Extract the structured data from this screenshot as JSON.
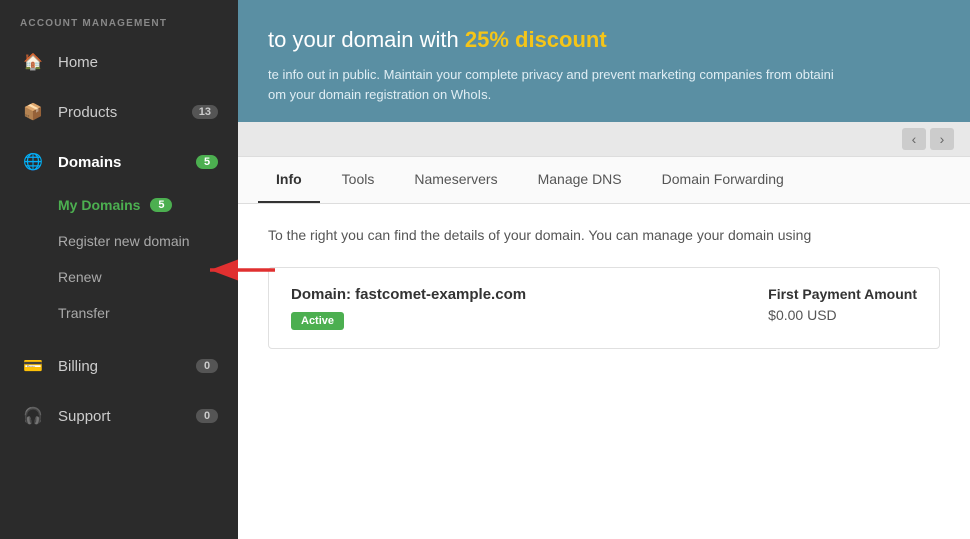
{
  "sidebar": {
    "section_label": "ACCOUNT MANAGEMENT",
    "items": [
      {
        "id": "home",
        "label": "Home",
        "icon": "🏠",
        "badge": null,
        "active": false
      },
      {
        "id": "products",
        "label": "Products",
        "icon": "📦",
        "badge": "13",
        "badge_color": "gray",
        "active": false
      },
      {
        "id": "domains",
        "label": "Domains",
        "icon": "🌐",
        "badge": "5",
        "badge_color": "green",
        "active": true
      },
      {
        "id": "billing",
        "label": "Billing",
        "icon": "💳",
        "badge": "0",
        "badge_color": "gray",
        "active": false
      },
      {
        "id": "support",
        "label": "Support",
        "icon": "🎧",
        "badge": "0",
        "badge_color": "gray",
        "active": false
      }
    ],
    "submenu": [
      {
        "id": "my-domains",
        "label": "My Domains",
        "badge": "5",
        "active": true
      },
      {
        "id": "register-new",
        "label": "Register new domain",
        "badge": null,
        "active": false
      },
      {
        "id": "renew",
        "label": "Renew",
        "badge": null,
        "active": false
      },
      {
        "id": "transfer",
        "label": "Transfer",
        "badge": null,
        "active": false
      }
    ]
  },
  "banner": {
    "title_start": "to your domain with ",
    "discount": "25% discount",
    "text_line1": "te info out in public. Maintain your complete privacy and prevent marketing companies from obtaini",
    "text_line2": "om your domain registration on WhoIs."
  },
  "tabs": [
    {
      "id": "info",
      "label": "Info",
      "active": true
    },
    {
      "id": "tools",
      "label": "Tools",
      "active": false
    },
    {
      "id": "nameservers",
      "label": "Nameservers",
      "active": false
    },
    {
      "id": "manage-dns",
      "label": "Manage DNS",
      "active": false
    },
    {
      "id": "domain-forwarding",
      "label": "Domain Forwarding",
      "active": false
    }
  ],
  "content": {
    "description": "To the right you can find the details of your domain. You can manage your domain using",
    "domain_card": {
      "label": "Domain: ",
      "domain_name": "fastcomet-example.com",
      "status": "Active",
      "payment_label": "First Payment Amount",
      "payment_amount": "$0.00 USD"
    }
  },
  "toggle": {
    "collapse_label": "‹",
    "expand_label": "›"
  }
}
